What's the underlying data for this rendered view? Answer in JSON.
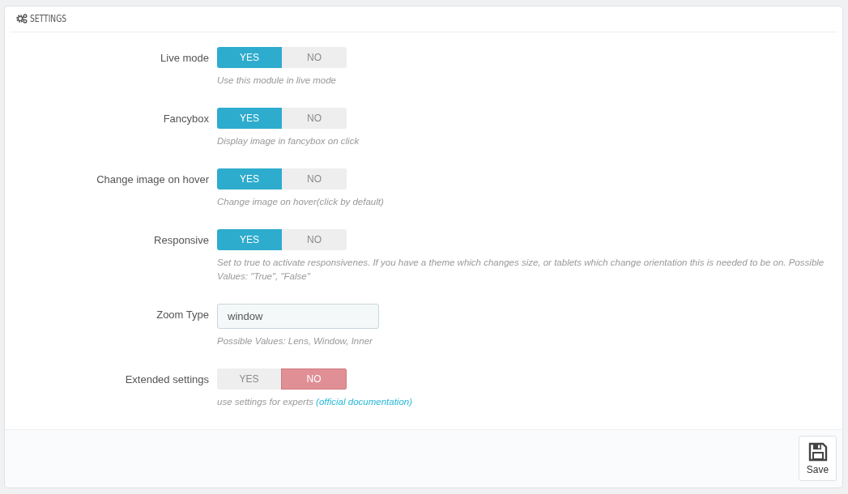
{
  "panel": {
    "title": "SETTINGS"
  },
  "fields": [
    {
      "kind": "switch",
      "label": "Live mode",
      "options": [
        "YES",
        "NO"
      ],
      "on": true,
      "help": "Use this module in live mode"
    },
    {
      "kind": "switch",
      "label": "Fancybox",
      "options": [
        "YES",
        "NO"
      ],
      "on": true,
      "help": "Display image in fancybox on click"
    },
    {
      "kind": "switch",
      "label": "Change image on hover",
      "options": [
        "YES",
        "NO"
      ],
      "on": true,
      "help": "Change image on hover(click by default)"
    },
    {
      "kind": "switch",
      "label": "Responsive",
      "options": [
        "YES",
        "NO"
      ],
      "on": true,
      "help": "Set to true to activate responsivenes. If you have a theme which changes size, or tablets which change orientation this is needed to be on. Possible Values: \"True\", \"False\""
    },
    {
      "kind": "text",
      "label": "Zoom Type",
      "value": "window",
      "help": "Possible Values: Lens, Window, Inner"
    },
    {
      "kind": "switch",
      "label": "Extended settings",
      "options": [
        "YES",
        "NO"
      ],
      "on": false,
      "help": "use settings for experts",
      "help_link": "(official documentation)"
    }
  ],
  "footer": {
    "save_label": "Save"
  }
}
